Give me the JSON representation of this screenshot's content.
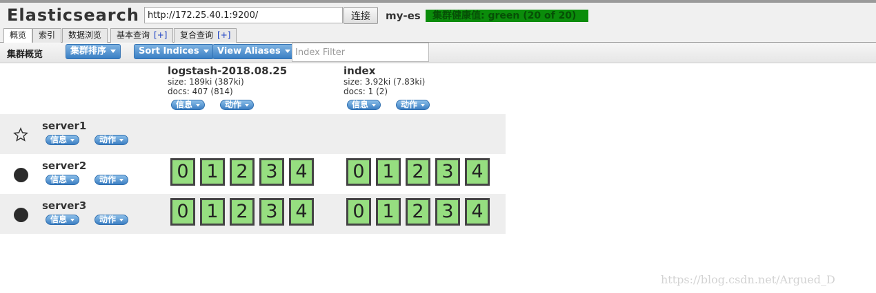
{
  "header": {
    "app_title": "Elasticsearch",
    "url_value": "http://172.25.40.1:9200/",
    "connect_label": "连接",
    "cluster_name": "my-es",
    "health_text": "集群健康值: green (20 of 20)",
    "health_color": "#0b8c0b"
  },
  "tabs": [
    {
      "label": "概览",
      "plus": ""
    },
    {
      "label": "索引",
      "plus": ""
    },
    {
      "label": "数据浏览",
      "plus": ""
    },
    {
      "label": "基本查询",
      "plus": "[+]"
    },
    {
      "label": "复合查询",
      "plus": "[+]"
    }
  ],
  "toolbar": {
    "title": "集群概览",
    "sort_cluster_label": "集群排序",
    "sort_indices_label": "Sort Indices",
    "view_aliases_label": "View Aliases",
    "filter_placeholder": "Index Filter"
  },
  "pill_labels": {
    "info": "信息",
    "action": "动作"
  },
  "indices": [
    {
      "name": "logstash-2018.08.25",
      "size": "size: 189ki (387ki)",
      "docs": "docs: 407 (814)"
    },
    {
      "name": "index",
      "size": "size: 3.92ki (7.83ki)",
      "docs": "docs: 1 (2)"
    }
  ],
  "servers": [
    {
      "name": "server1",
      "icon": "star-outline-icon",
      "shards": [
        [],
        []
      ]
    },
    {
      "name": "server2",
      "icon": "filled-circle-icon",
      "shards": [
        [
          "0",
          "1",
          "2",
          "3",
          "4"
        ],
        [
          "0",
          "1",
          "2",
          "3",
          "4"
        ]
      ]
    },
    {
      "name": "server3",
      "icon": "filled-circle-icon",
      "shards": [
        [
          "0",
          "1",
          "2",
          "3",
          "4"
        ],
        [
          "0",
          "1",
          "2",
          "3",
          "4"
        ]
      ]
    }
  ],
  "shard_color": "#96de80",
  "watermark": "https://blog.csdn.net/Argued_D"
}
